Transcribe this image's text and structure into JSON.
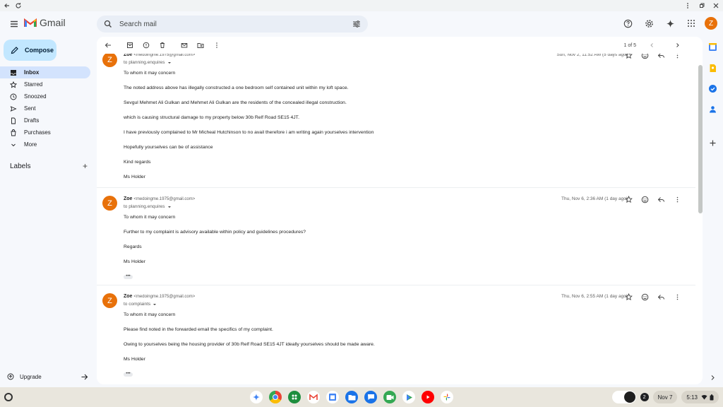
{
  "colors": {
    "accent": "#0b57d0",
    "compose_bg": "#c2e7ff",
    "active_nav": "#d3e3fd",
    "avatar": "#e8710a"
  },
  "header": {
    "app_name": "Gmail",
    "search_placeholder": "Search mail",
    "account_initial": "Z"
  },
  "sidebar": {
    "compose_label": "Compose",
    "items": [
      {
        "label": "Inbox",
        "icon": "inbox-icon"
      },
      {
        "label": "Starred",
        "icon": "star-icon"
      },
      {
        "label": "Snoozed",
        "icon": "clock-icon"
      },
      {
        "label": "Sent",
        "icon": "send-icon"
      },
      {
        "label": "Drafts",
        "icon": "file-icon"
      },
      {
        "label": "Purchases",
        "icon": "tag-icon"
      },
      {
        "label": "More",
        "icon": "chevron-down-icon"
      }
    ],
    "labels_title": "Labels",
    "labels_add": "+",
    "upgrade_label": "Upgrade"
  },
  "toolbar": {
    "pager": "1 of 5"
  },
  "messages": [
    {
      "initial": "Z",
      "sender": "Zoe",
      "address": "<medoingme.1975@gmail.com>",
      "to": "to planning.enquires",
      "date": "Sun, Nov 2, 11:52 AM (5 days ago)",
      "lines": [
        "To whom it may concern",
        "The noted address above has illegally constructed a one bedroom self contained unit within my loft space.",
        "Sevgul Mehmet Ali Gulkan and Mehmet Ali Gulkan are the residents of the concealed illegal construction.",
        " which is causing structural damage to my property below 30b Relf Road SE15 4JT.",
        "I have previously  complained to Mr  Micheal Hutchinson to no avail therefore i am writing again yourselves intervention",
        "Hopefully yourselves can be of assistance",
        "Kind regards",
        "Ms Holder"
      ]
    },
    {
      "initial": "Z",
      "sender": "Zoe",
      "address": "<medoingme.1975@gmail.com>",
      "to": "to planning.enquires",
      "date": "Thu, Nov 6, 2:36 AM (1 day ago)",
      "lines": [
        "To whom it may concern",
        "Further to my complaint is advisory available within policy and guidelines procedures?",
        "Regards",
        "Ms Holder"
      ],
      "ellipsis": "•••"
    },
    {
      "initial": "Z",
      "sender": "Zoe",
      "address": "<medoingme.1975@gmail.com>",
      "to": "to complaints",
      "date": "Thu, Nov 6, 2:55 AM (1 day ago)",
      "lines": [
        "To whom it may concern",
        "Please find noted in the forwarded email the specifics of my complaint.",
        "Owing to yourselves being the housing provider of 30b Relf Road SE15 4JT ideally yourselves should be made aware.",
        "Ms Holder"
      ],
      "ellipsis": "•••"
    }
  ],
  "taskbar": {
    "date": "Nov 7",
    "time": "5:13",
    "notification_count": "2"
  }
}
